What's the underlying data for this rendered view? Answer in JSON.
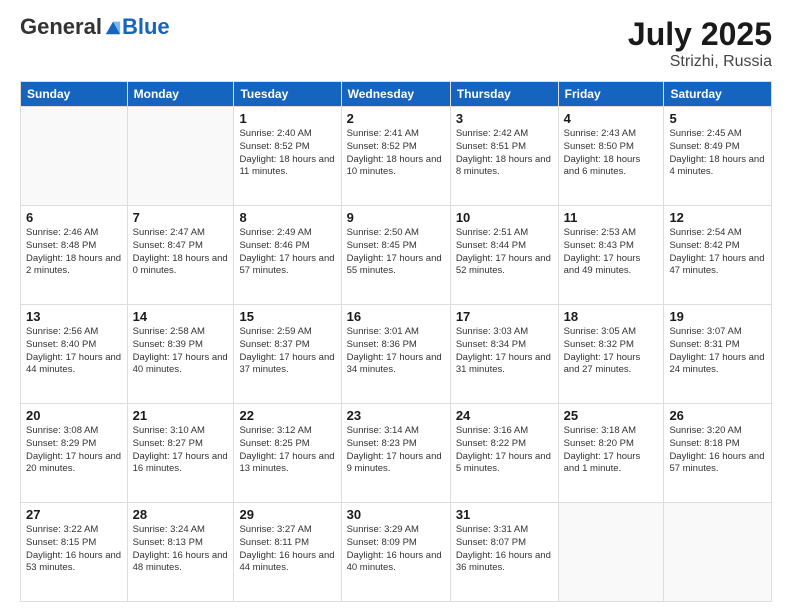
{
  "header": {
    "logo": {
      "general": "General",
      "blue": "Blue",
      "tagline": ""
    },
    "title": "July 2025",
    "location": "Strizhi, Russia"
  },
  "weekdays": [
    "Sunday",
    "Monday",
    "Tuesday",
    "Wednesday",
    "Thursday",
    "Friday",
    "Saturday"
  ],
  "weeks": [
    [
      {
        "day": "",
        "info": ""
      },
      {
        "day": "",
        "info": ""
      },
      {
        "day": "1",
        "info": "Sunrise: 2:40 AM\nSunset: 8:52 PM\nDaylight: 18 hours and 11 minutes."
      },
      {
        "day": "2",
        "info": "Sunrise: 2:41 AM\nSunset: 8:52 PM\nDaylight: 18 hours and 10 minutes."
      },
      {
        "day": "3",
        "info": "Sunrise: 2:42 AM\nSunset: 8:51 PM\nDaylight: 18 hours and 8 minutes."
      },
      {
        "day": "4",
        "info": "Sunrise: 2:43 AM\nSunset: 8:50 PM\nDaylight: 18 hours and 6 minutes."
      },
      {
        "day": "5",
        "info": "Sunrise: 2:45 AM\nSunset: 8:49 PM\nDaylight: 18 hours and 4 minutes."
      }
    ],
    [
      {
        "day": "6",
        "info": "Sunrise: 2:46 AM\nSunset: 8:48 PM\nDaylight: 18 hours and 2 minutes."
      },
      {
        "day": "7",
        "info": "Sunrise: 2:47 AM\nSunset: 8:47 PM\nDaylight: 18 hours and 0 minutes."
      },
      {
        "day": "8",
        "info": "Sunrise: 2:49 AM\nSunset: 8:46 PM\nDaylight: 17 hours and 57 minutes."
      },
      {
        "day": "9",
        "info": "Sunrise: 2:50 AM\nSunset: 8:45 PM\nDaylight: 17 hours and 55 minutes."
      },
      {
        "day": "10",
        "info": "Sunrise: 2:51 AM\nSunset: 8:44 PM\nDaylight: 17 hours and 52 minutes."
      },
      {
        "day": "11",
        "info": "Sunrise: 2:53 AM\nSunset: 8:43 PM\nDaylight: 17 hours and 49 minutes."
      },
      {
        "day": "12",
        "info": "Sunrise: 2:54 AM\nSunset: 8:42 PM\nDaylight: 17 hours and 47 minutes."
      }
    ],
    [
      {
        "day": "13",
        "info": "Sunrise: 2:56 AM\nSunset: 8:40 PM\nDaylight: 17 hours and 44 minutes."
      },
      {
        "day": "14",
        "info": "Sunrise: 2:58 AM\nSunset: 8:39 PM\nDaylight: 17 hours and 40 minutes."
      },
      {
        "day": "15",
        "info": "Sunrise: 2:59 AM\nSunset: 8:37 PM\nDaylight: 17 hours and 37 minutes."
      },
      {
        "day": "16",
        "info": "Sunrise: 3:01 AM\nSunset: 8:36 PM\nDaylight: 17 hours and 34 minutes."
      },
      {
        "day": "17",
        "info": "Sunrise: 3:03 AM\nSunset: 8:34 PM\nDaylight: 17 hours and 31 minutes."
      },
      {
        "day": "18",
        "info": "Sunrise: 3:05 AM\nSunset: 8:32 PM\nDaylight: 17 hours and 27 minutes."
      },
      {
        "day": "19",
        "info": "Sunrise: 3:07 AM\nSunset: 8:31 PM\nDaylight: 17 hours and 24 minutes."
      }
    ],
    [
      {
        "day": "20",
        "info": "Sunrise: 3:08 AM\nSunset: 8:29 PM\nDaylight: 17 hours and 20 minutes."
      },
      {
        "day": "21",
        "info": "Sunrise: 3:10 AM\nSunset: 8:27 PM\nDaylight: 17 hours and 16 minutes."
      },
      {
        "day": "22",
        "info": "Sunrise: 3:12 AM\nSunset: 8:25 PM\nDaylight: 17 hours and 13 minutes."
      },
      {
        "day": "23",
        "info": "Sunrise: 3:14 AM\nSunset: 8:23 PM\nDaylight: 17 hours and 9 minutes."
      },
      {
        "day": "24",
        "info": "Sunrise: 3:16 AM\nSunset: 8:22 PM\nDaylight: 17 hours and 5 minutes."
      },
      {
        "day": "25",
        "info": "Sunrise: 3:18 AM\nSunset: 8:20 PM\nDaylight: 17 hours and 1 minute."
      },
      {
        "day": "26",
        "info": "Sunrise: 3:20 AM\nSunset: 8:18 PM\nDaylight: 16 hours and 57 minutes."
      }
    ],
    [
      {
        "day": "27",
        "info": "Sunrise: 3:22 AM\nSunset: 8:15 PM\nDaylight: 16 hours and 53 minutes."
      },
      {
        "day": "28",
        "info": "Sunrise: 3:24 AM\nSunset: 8:13 PM\nDaylight: 16 hours and 48 minutes."
      },
      {
        "day": "29",
        "info": "Sunrise: 3:27 AM\nSunset: 8:11 PM\nDaylight: 16 hours and 44 minutes."
      },
      {
        "day": "30",
        "info": "Sunrise: 3:29 AM\nSunset: 8:09 PM\nDaylight: 16 hours and 40 minutes."
      },
      {
        "day": "31",
        "info": "Sunrise: 3:31 AM\nSunset: 8:07 PM\nDaylight: 16 hours and 36 minutes."
      },
      {
        "day": "",
        "info": ""
      },
      {
        "day": "",
        "info": ""
      }
    ]
  ]
}
